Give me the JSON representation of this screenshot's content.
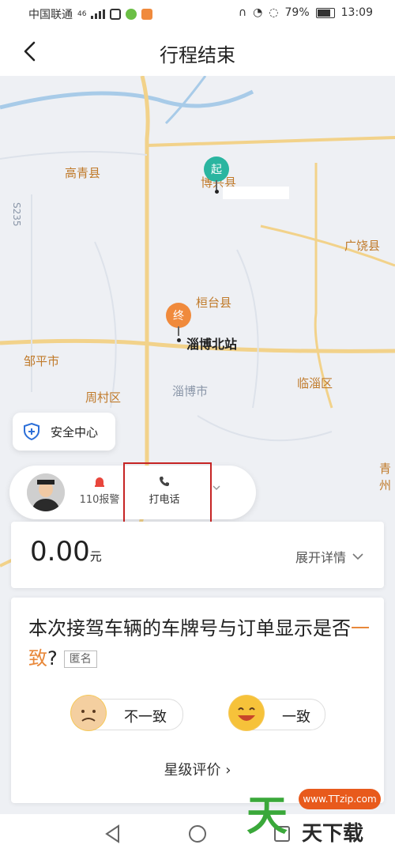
{
  "status_bar": {
    "carrier": "中国联通",
    "network": "46",
    "battery": "79%",
    "time": "13:09"
  },
  "header": {
    "title": "行程结束"
  },
  "map": {
    "labels": {
      "gaoqing": "高青县",
      "boxing": "博兴县",
      "s235": "S235",
      "guangrao": "广饶县",
      "huantai": "桓台县",
      "zoubo_bei": "淄博北站",
      "zouping": "邹平市",
      "zhoucun": "周村区",
      "zibo": "淄博市",
      "linzi": "临淄区",
      "qingzhou": "青州"
    },
    "start_marker": "起",
    "end_marker": "终"
  },
  "safety": {
    "label": "安全中心"
  },
  "driver_bar": {
    "alarm_label": "110报警",
    "call_label": "打电话"
  },
  "price": {
    "amount": "0.00",
    "unit": "元",
    "details_label": "展开详情"
  },
  "question": {
    "text_main": "本次接驾车辆的车牌号与订单显示是否",
    "text_accent": "一致",
    "text_end": "?",
    "anonymous": "匿名",
    "option_no": "不一致",
    "option_yes": "一致",
    "rating_label": "星级评价 ›"
  },
  "watermark": {
    "url": "www.TTzip.com",
    "logo": "天",
    "words": "天下载"
  },
  "colors": {
    "accent": "#e8883a",
    "start_pin": "#2ab5a0",
    "end_pin": "#f08a3c",
    "highlight": "#c62424"
  }
}
